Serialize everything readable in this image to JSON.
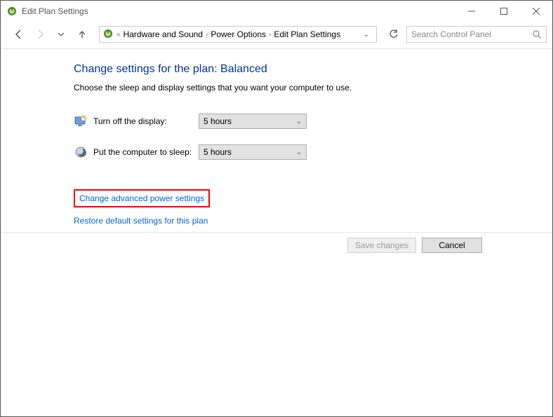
{
  "window": {
    "title": "Edit Plan Settings"
  },
  "breadcrumb": {
    "prefix": "«",
    "items": [
      "Hardware and Sound",
      "Power Options",
      "Edit Plan Settings"
    ]
  },
  "search": {
    "placeholder": "Search Control Panel"
  },
  "heading": "Change settings for the plan: Balanced",
  "subtext": "Choose the sleep and display settings that you want your computer to use.",
  "settings": {
    "display_off": {
      "label": "Turn off the display:",
      "value": "5 hours"
    },
    "sleep": {
      "label": "Put the computer to sleep:",
      "value": "5 hours"
    }
  },
  "links": {
    "advanced": "Change advanced power settings",
    "restore": "Restore default settings for this plan"
  },
  "buttons": {
    "save": "Save changes",
    "cancel": "Cancel"
  }
}
